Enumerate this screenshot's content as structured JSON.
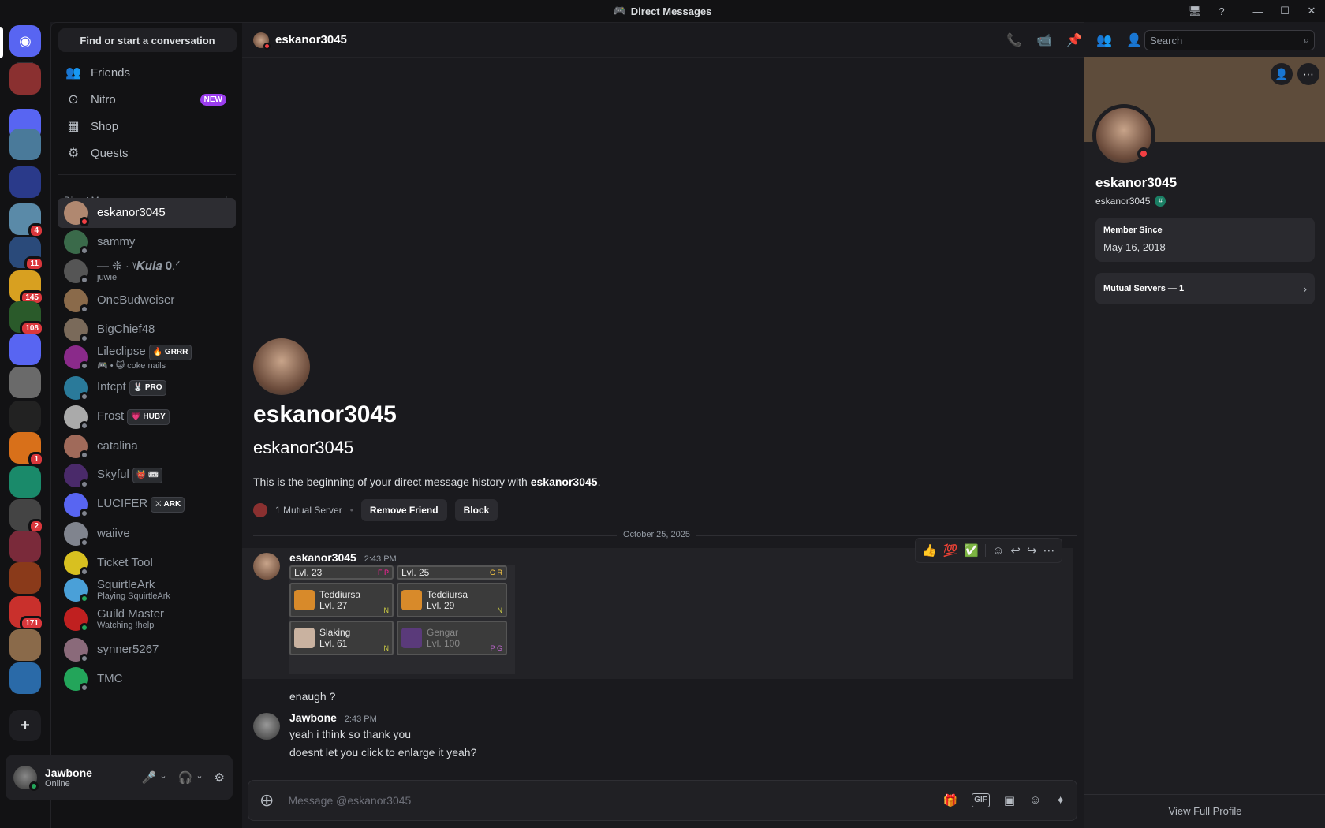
{
  "window": {
    "title": "Direct Messages"
  },
  "rail": {
    "servers": [
      {
        "badge": ""
      },
      {
        "badge": ""
      },
      {
        "badge": ""
      },
      {
        "badge": ""
      },
      {
        "badge": "4"
      },
      {
        "badge": "11"
      },
      {
        "badge": "145"
      },
      {
        "badge": "108"
      },
      {
        "badge": ""
      },
      {
        "badge": ""
      },
      {
        "badge": ""
      },
      {
        "badge": "1"
      },
      {
        "badge": ""
      },
      {
        "badge": "2"
      },
      {
        "badge": ""
      },
      {
        "badge": ""
      },
      {
        "badge": "171"
      },
      {
        "badge": ""
      },
      {
        "badge": ""
      }
    ]
  },
  "sidebar": {
    "find_label": "Find or start a conversation",
    "nav": [
      {
        "label": "Friends",
        "icon": "friends-icon"
      },
      {
        "label": "Nitro",
        "icon": "nitro-icon",
        "badge": "NEW"
      },
      {
        "label": "Shop",
        "icon": "shop-icon"
      },
      {
        "label": "Quests",
        "icon": "quests-icon"
      }
    ],
    "dm_header": "Direct Messages",
    "dms": [
      {
        "name": "eskanor3045",
        "sub": "",
        "tag": "",
        "status": "dnd"
      },
      {
        "name": "sammy",
        "sub": "",
        "tag": "",
        "status": "off"
      },
      {
        "name": "— ❊ · ᵞ𝑲𝒖𝒍𝒂 𝟎.ᐟ",
        "sub": "juwie",
        "tag": "",
        "status": "off"
      },
      {
        "name": "OneBudweiser",
        "sub": "",
        "tag": "",
        "status": "off"
      },
      {
        "name": "BigChief48",
        "sub": "",
        "tag": "",
        "status": "off"
      },
      {
        "name": "Lileclipse",
        "sub": "🎮 • 😺 coke nails",
        "tag": "🔥 GRRR",
        "status": "off"
      },
      {
        "name": "Intcpt",
        "sub": "",
        "tag": "🐰 PRO",
        "status": "off"
      },
      {
        "name": "Frost",
        "sub": "",
        "tag": "💗 HUBY",
        "status": "off"
      },
      {
        "name": "catalina",
        "sub": "",
        "tag": "",
        "status": "off"
      },
      {
        "name": "Skyful",
        "sub": "",
        "tag": "👹 🎟",
        "status": "off"
      },
      {
        "name": "LUCIFER",
        "sub": "",
        "tag": "⚔ ARK",
        "status": "off"
      },
      {
        "name": "waiive",
        "sub": "",
        "tag": "",
        "status": "off"
      },
      {
        "name": "Ticket Tool",
        "sub": "",
        "tag": "",
        "status": "off"
      },
      {
        "name": "SquirtleArk",
        "sub": "Playing SquirtleArk",
        "tag": "",
        "status": "on"
      },
      {
        "name": "Guild Master",
        "sub": "Watching !help",
        "tag": "",
        "status": "on"
      },
      {
        "name": "synner5267",
        "sub": "",
        "tag": "",
        "status": "off"
      },
      {
        "name": "TMC",
        "sub": "",
        "tag": "",
        "status": "off"
      }
    ]
  },
  "user_panel": {
    "name": "Jawbone",
    "status": "Online"
  },
  "header": {
    "name": "eskanor3045",
    "search_placeholder": "Search"
  },
  "intro": {
    "display_name": "eskanor3045",
    "username": "eskanor3045",
    "text_pre": "This is the beginning of your direct message history with ",
    "text_name": "eskanor3045",
    "text_post": ".",
    "mutual": "1 Mutual Server",
    "remove_friend": "Remove Friend",
    "block": "Block"
  },
  "date_divider": "October 25, 2025",
  "reactions": [
    "👍",
    "💯",
    "✅"
  ],
  "messages": [
    {
      "author": "eskanor3045",
      "time": "2:43 PM",
      "lines": [
        "enaugh ?"
      ]
    },
    {
      "author": "Jawbone",
      "time": "2:43 PM",
      "lines": [
        "yeah i think so thank you",
        "doesnt let you click to enlarge it yeah?"
      ]
    }
  ],
  "pokemon": [
    {
      "name": "",
      "level": "Lvl. 23",
      "flags": "F P"
    },
    {
      "name": "",
      "level": "Lvl. 25",
      "flags": "G R"
    },
    {
      "name": "Teddiursa",
      "level": "Lvl. 27",
      "flags": "N"
    },
    {
      "name": "Teddiursa",
      "level": "Lvl. 29",
      "flags": "N"
    },
    {
      "name": "Slaking",
      "level": "Lvl. 61",
      "flags": "N"
    },
    {
      "name": "Gengar",
      "level": "Lvl. 100",
      "flags": "P G"
    }
  ],
  "composer": {
    "placeholder": "Message @eskanor3045"
  },
  "profile": {
    "display_name": "eskanor3045",
    "username": "eskanor3045",
    "member_since_label": "Member Since",
    "member_since": "May 16, 2018",
    "mutual_servers": "Mutual Servers — 1",
    "view_full": "View Full Profile"
  },
  "colors": {
    "accent": "#5865f2",
    "online": "#23a55a",
    "dnd": "#f23f43",
    "nitro_badge": "#9b3dee"
  }
}
